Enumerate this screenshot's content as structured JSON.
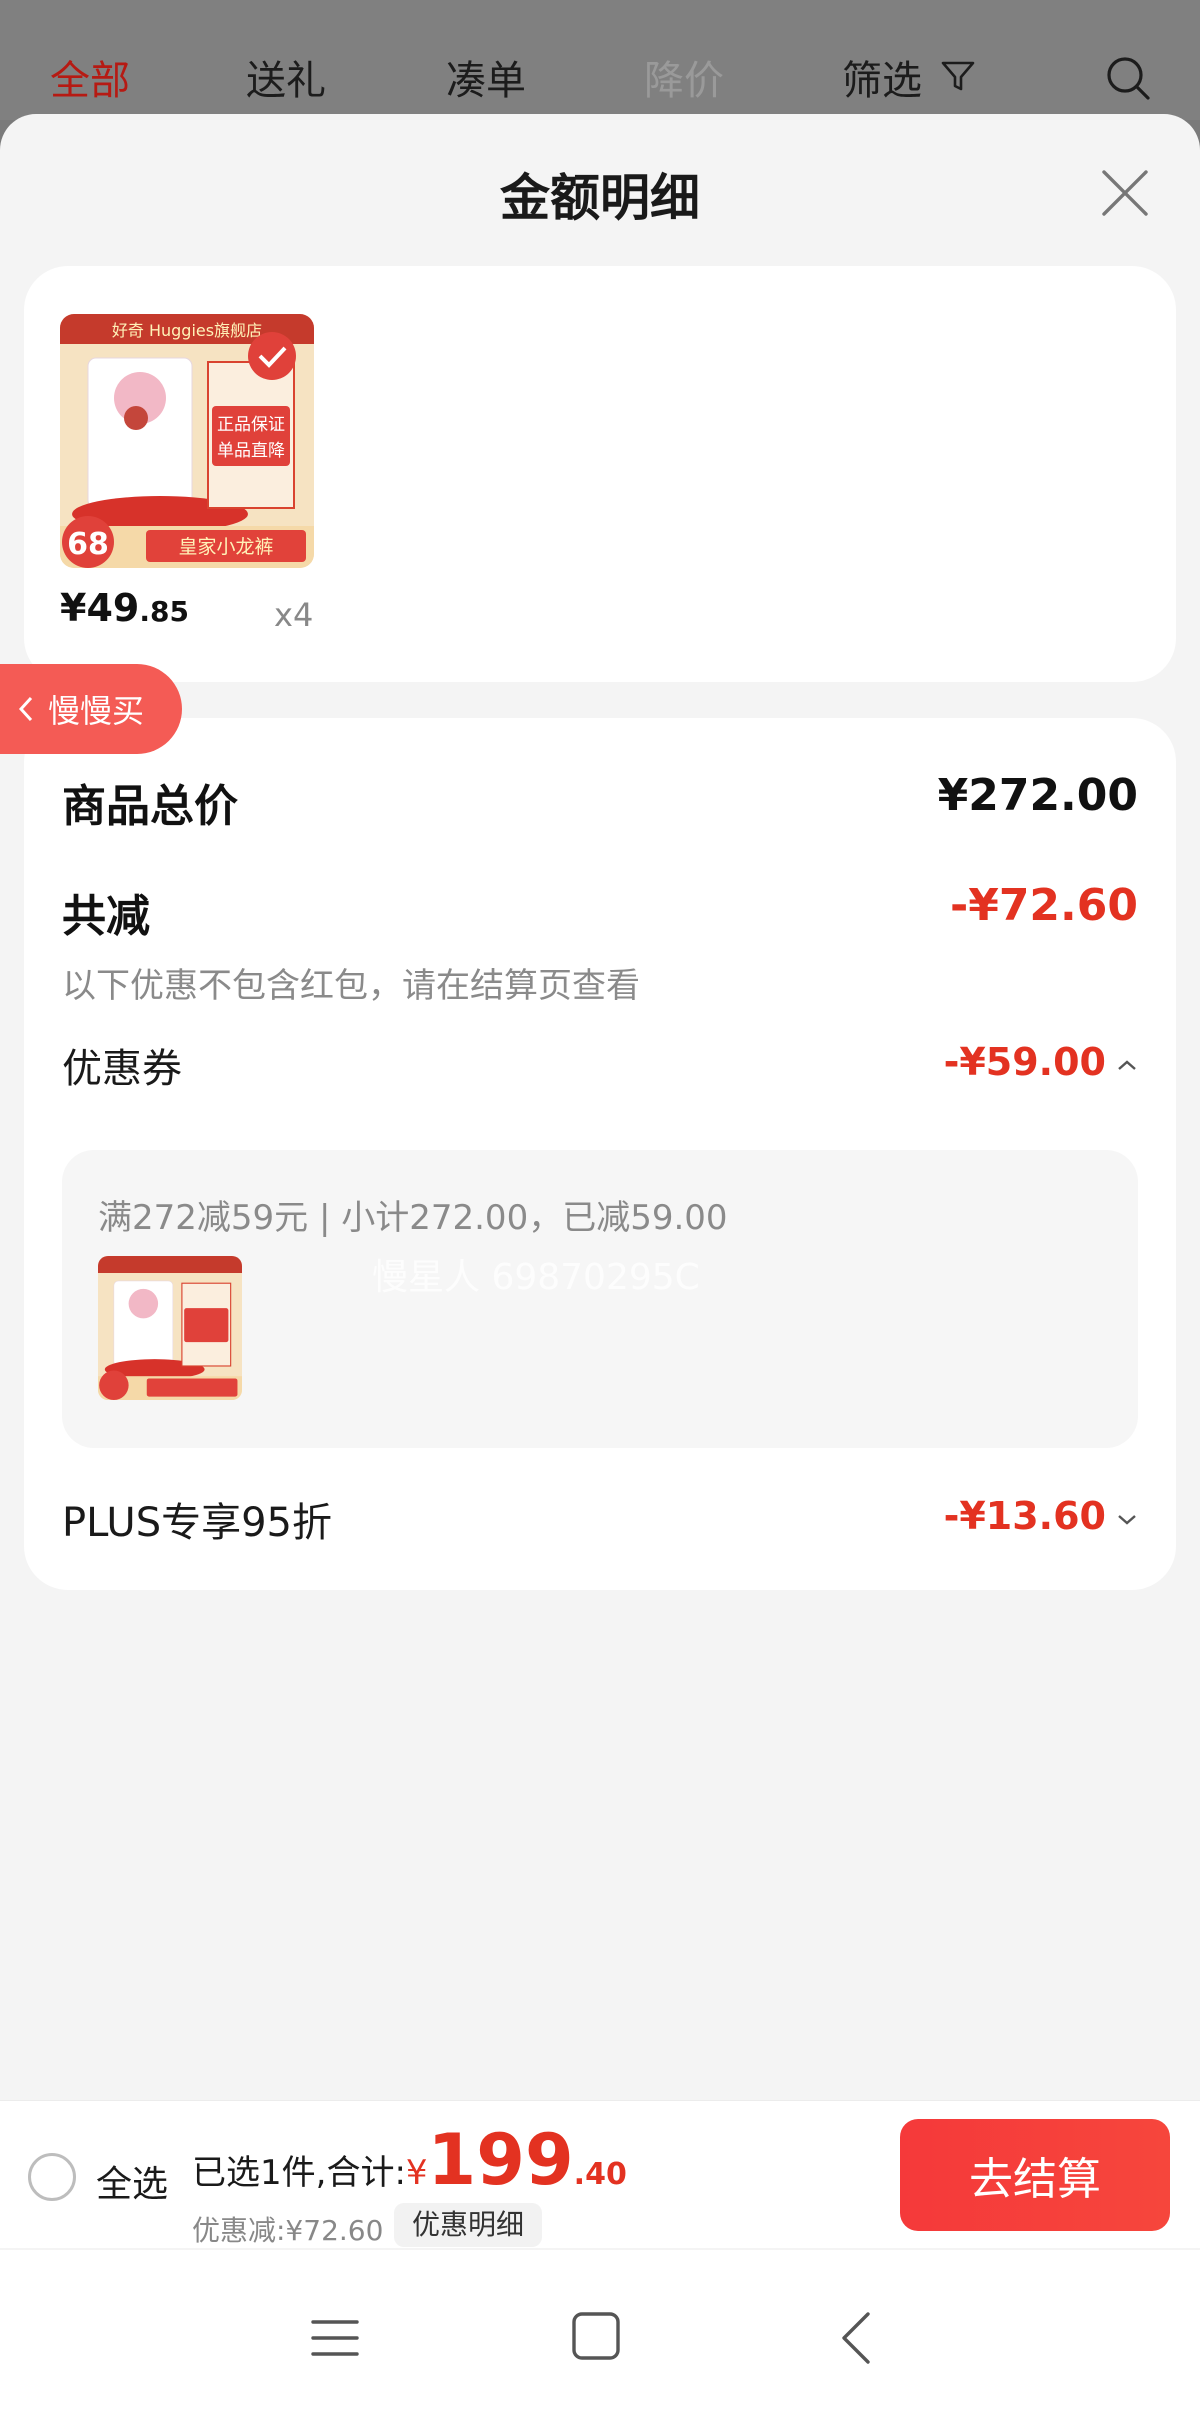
{
  "top_tabs": [
    "全部",
    "送礼",
    "凑单",
    "降价",
    "筛选"
  ],
  "sheet": {
    "title": "金额明细"
  },
  "product": {
    "store_name": "好奇 Huggies旗舰店",
    "thumb_badge_1": "正品保证",
    "thumb_badge_2": "单品直降",
    "thumb_bottom": "皇家小龙裤",
    "thumb_number": "68",
    "price_main": "¥49",
    "price_cents": ".85",
    "quantity": "x4"
  },
  "side_pill": {
    "label": "慢慢买"
  },
  "details": {
    "total_label": "商品总价",
    "total_value": "¥272.00",
    "discount_label": "共减",
    "discount_value": "-¥72.60",
    "discount_hint": "以下优惠不包含红包，请在结算页查看",
    "coupon_label": "优惠券",
    "coupon_value": "-¥59.00",
    "coupon_desc": "满272减59元 | 小计272.00，已减59.00",
    "plus_label": "PLUS专享95折",
    "plus_value": "-¥13.60"
  },
  "watermark": "慢星人 69870295C",
  "bottom_bar": {
    "select_all": "全选",
    "selected_text": "已选1件,合计:",
    "yen": "¥",
    "total_int": "199",
    "total_cents": ".40",
    "discount_text": "优惠减:¥72.60",
    "detail_tag": "优惠明细",
    "checkout_label": "去结算"
  },
  "colors": {
    "accent_red": "#e33221",
    "tab_active": "#b61a13",
    "pill": "#f45b55"
  }
}
